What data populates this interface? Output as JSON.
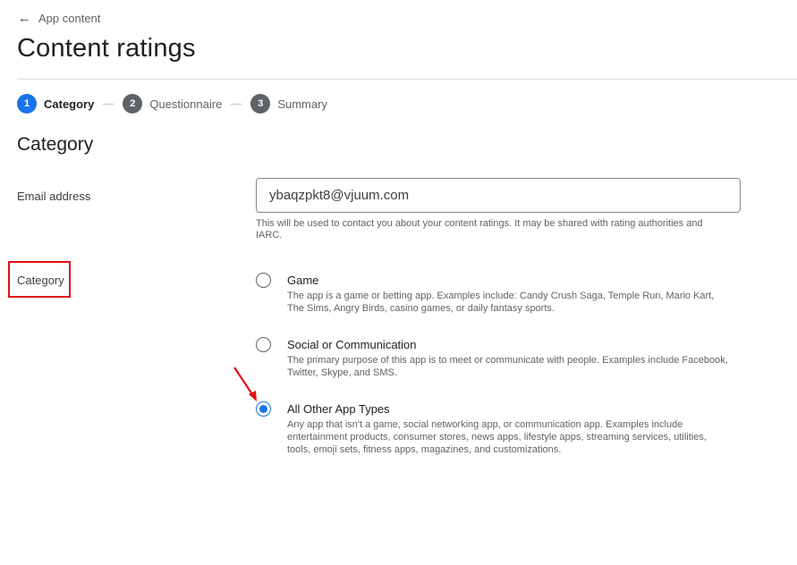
{
  "header": {
    "back_label": "App content",
    "back_icon": "arrow-left-icon",
    "title": "Content ratings"
  },
  "stepper": {
    "steps": [
      {
        "number": "1",
        "label": "Category",
        "active": true
      },
      {
        "number": "2",
        "label": "Questionnaire",
        "active": false
      },
      {
        "number": "3",
        "label": "Summary",
        "active": false
      }
    ]
  },
  "section": {
    "title": "Category"
  },
  "email": {
    "label": "Email address",
    "value": "ybaqzpkt8@vjuum.com",
    "helper": "This will be used to contact you about your content ratings. It may be shared with rating authorities and IARC."
  },
  "category": {
    "label": "Category",
    "options": [
      {
        "title": "Game",
        "description": "The app is a game or betting app. Examples include: Candy Crush Saga, Temple Run, Mario Kart, The Sims, Angry Birds, casino games, or daily fantasy sports.",
        "selected": false
      },
      {
        "title": "Social or Communication",
        "description": "The primary purpose of this app is to meet or communicate with people. Examples include Facebook, Twitter, Skype, and SMS.",
        "selected": false
      },
      {
        "title": "All Other App Types",
        "description": "Any app that isn't a game, social networking app, or communication app. Examples include entertainment products, consumer stores, news apps, lifestyle apps, streaming services, utilities, tools, emoji sets, fitness apps, magazines, and customizations.",
        "selected": true
      }
    ]
  },
  "colors": {
    "accent": "#1a73e8",
    "annotation": "#e01010"
  }
}
